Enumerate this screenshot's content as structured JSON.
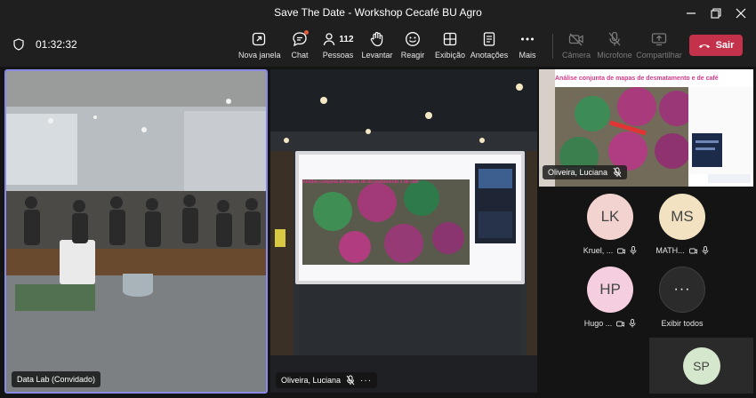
{
  "window": {
    "title": "Save The Date - Workshop Cecafé BU Agro"
  },
  "toolbar": {
    "timer": "01:32:32",
    "people_count": "112",
    "buttons": {
      "new_window": "Nova janela",
      "chat": "Chat",
      "people": "Pessoas",
      "raise": "Levantar",
      "react": "Reagir",
      "view": "Exibição",
      "notes": "Anotações",
      "more": "Mais",
      "camera": "Câmera",
      "mic": "Microfone",
      "share": "Compartilhar",
      "leave": "Sair"
    }
  },
  "stage": {
    "tile1_name": "Data Lab (Convidado)",
    "tile2_name": "Oliveira, Luciana",
    "tile3_name": "Oliveira, Luciana",
    "slide_title": "Análise conjunta de mapas de desmatamento e de café",
    "presentation_title": "Análise conjunta de mapas de desmatamento e de café"
  },
  "participants": [
    {
      "initials": "LK",
      "name": "Kruel, ...",
      "color": "#f3d3cf"
    },
    {
      "initials": "MS",
      "name": "MATH...",
      "color": "#f3e2c2"
    },
    {
      "initials": "HP",
      "name": "Hugo ...",
      "color": "#f5cfe0"
    }
  ],
  "see_all": "Exibir todos",
  "self": {
    "initials": "SP",
    "color": "#d5e8cd"
  }
}
